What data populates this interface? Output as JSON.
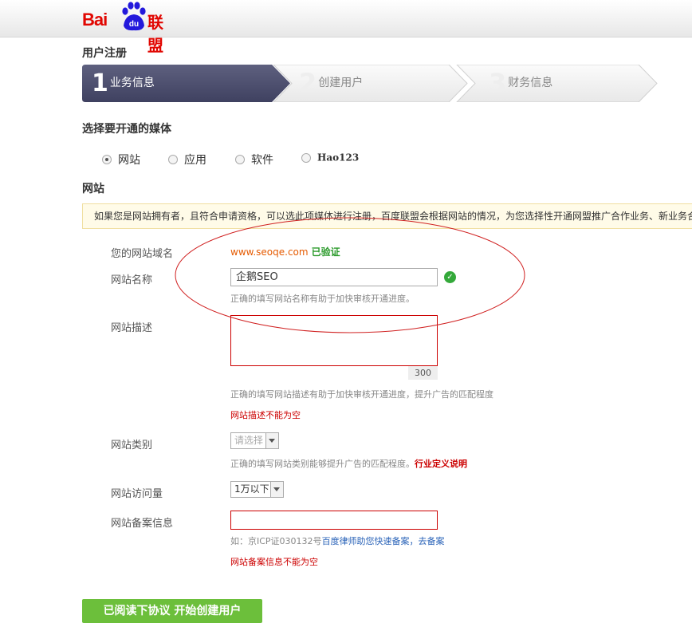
{
  "brand": {
    "logo_text_left": "Bai",
    "logo_text_paw": "du",
    "logo_text_right": "联盟"
  },
  "page": {
    "title": "用户注册"
  },
  "steps": [
    {
      "num": "1",
      "label": "业务信息",
      "active": true
    },
    {
      "num": "2",
      "label": "创建用户",
      "active": false
    },
    {
      "num": "3",
      "label": "财务信息",
      "active": false
    }
  ],
  "media": {
    "heading": "选择要开通的媒体",
    "options": [
      {
        "label": "网站",
        "selected": true
      },
      {
        "label": "应用",
        "selected": false
      },
      {
        "label": "软件",
        "selected": false
      },
      {
        "label": "Hao123",
        "selected": false
      }
    ]
  },
  "website": {
    "heading": "网站",
    "notice": "如果您是网站拥有者，且符合申请资格，可以选此项媒体进行注册，百度联盟会根据网站的情况，为您选择性开通网盟推广合作业务、新业务合",
    "domain_label": "您的网站域名",
    "domain_value": "www.seoqe.com",
    "domain_status": "已验证",
    "name_label": "网站名称",
    "name_value": "企鹅SEO",
    "name_hint": "正确的填写网站名称有助于加快审核开通进度。",
    "desc_label": "网站描述",
    "desc_counter": "300",
    "desc_hint": "正确的填写网站描述有助于加快审核开通进度，提升广告的匹配程度",
    "desc_error": "网站描述不能为空",
    "category_label": "网站类别",
    "category_value": "请选择",
    "category_hint": "正确的填写网站类别能够提升广告的匹配程度。",
    "category_link": "行业定义说明",
    "traffic_label": "网站访问量",
    "traffic_value": "1万以下",
    "beian_label": "网站备案信息",
    "beian_hint_prefix": "如：京ICP证030132号",
    "beian_hint_link": "百度律师助您快速备案，去备案",
    "beian_error": "网站备案信息不能为空"
  },
  "submit": {
    "label": "已阅读下协议 开始创建用户"
  },
  "colors": {
    "brand_red": "#e10601",
    "step_active": "#4d4f6e",
    "error": "#cc0000",
    "verified": "#2a9a2a",
    "annotation": "#d02020"
  }
}
